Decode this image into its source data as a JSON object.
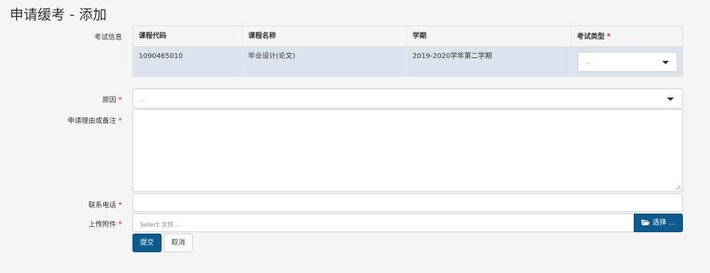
{
  "page": {
    "title": "申请缓考 - 添加"
  },
  "exam_info": {
    "label": "考试信息",
    "columns": [
      "课程代码",
      "课程名称",
      "学期",
      "考试类型"
    ],
    "required_mark": "*",
    "rows": [
      {
        "course_code": "1090465010",
        "course_name": "毕业设计(论文)",
        "term": "2019-2020学年第二学期",
        "exam_type_placeholder": "..."
      }
    ]
  },
  "reason": {
    "label": "原因",
    "placeholder": "..."
  },
  "remarks": {
    "label": "申请理由或备注",
    "value": ""
  },
  "phone": {
    "label": "联系电话",
    "value": ""
  },
  "attachment": {
    "label": "上传附件",
    "placeholder": "Select 文件...",
    "browse_label": "选择 ..."
  },
  "actions": {
    "submit_label": "提交",
    "cancel_label": "取消"
  },
  "colors": {
    "primary": "#0f5a8c",
    "required": "#e02020",
    "selected_row": "#dbe3ee"
  },
  "icons": {
    "browse": "folder-open-icon",
    "dropdown": "caret-down-icon"
  }
}
